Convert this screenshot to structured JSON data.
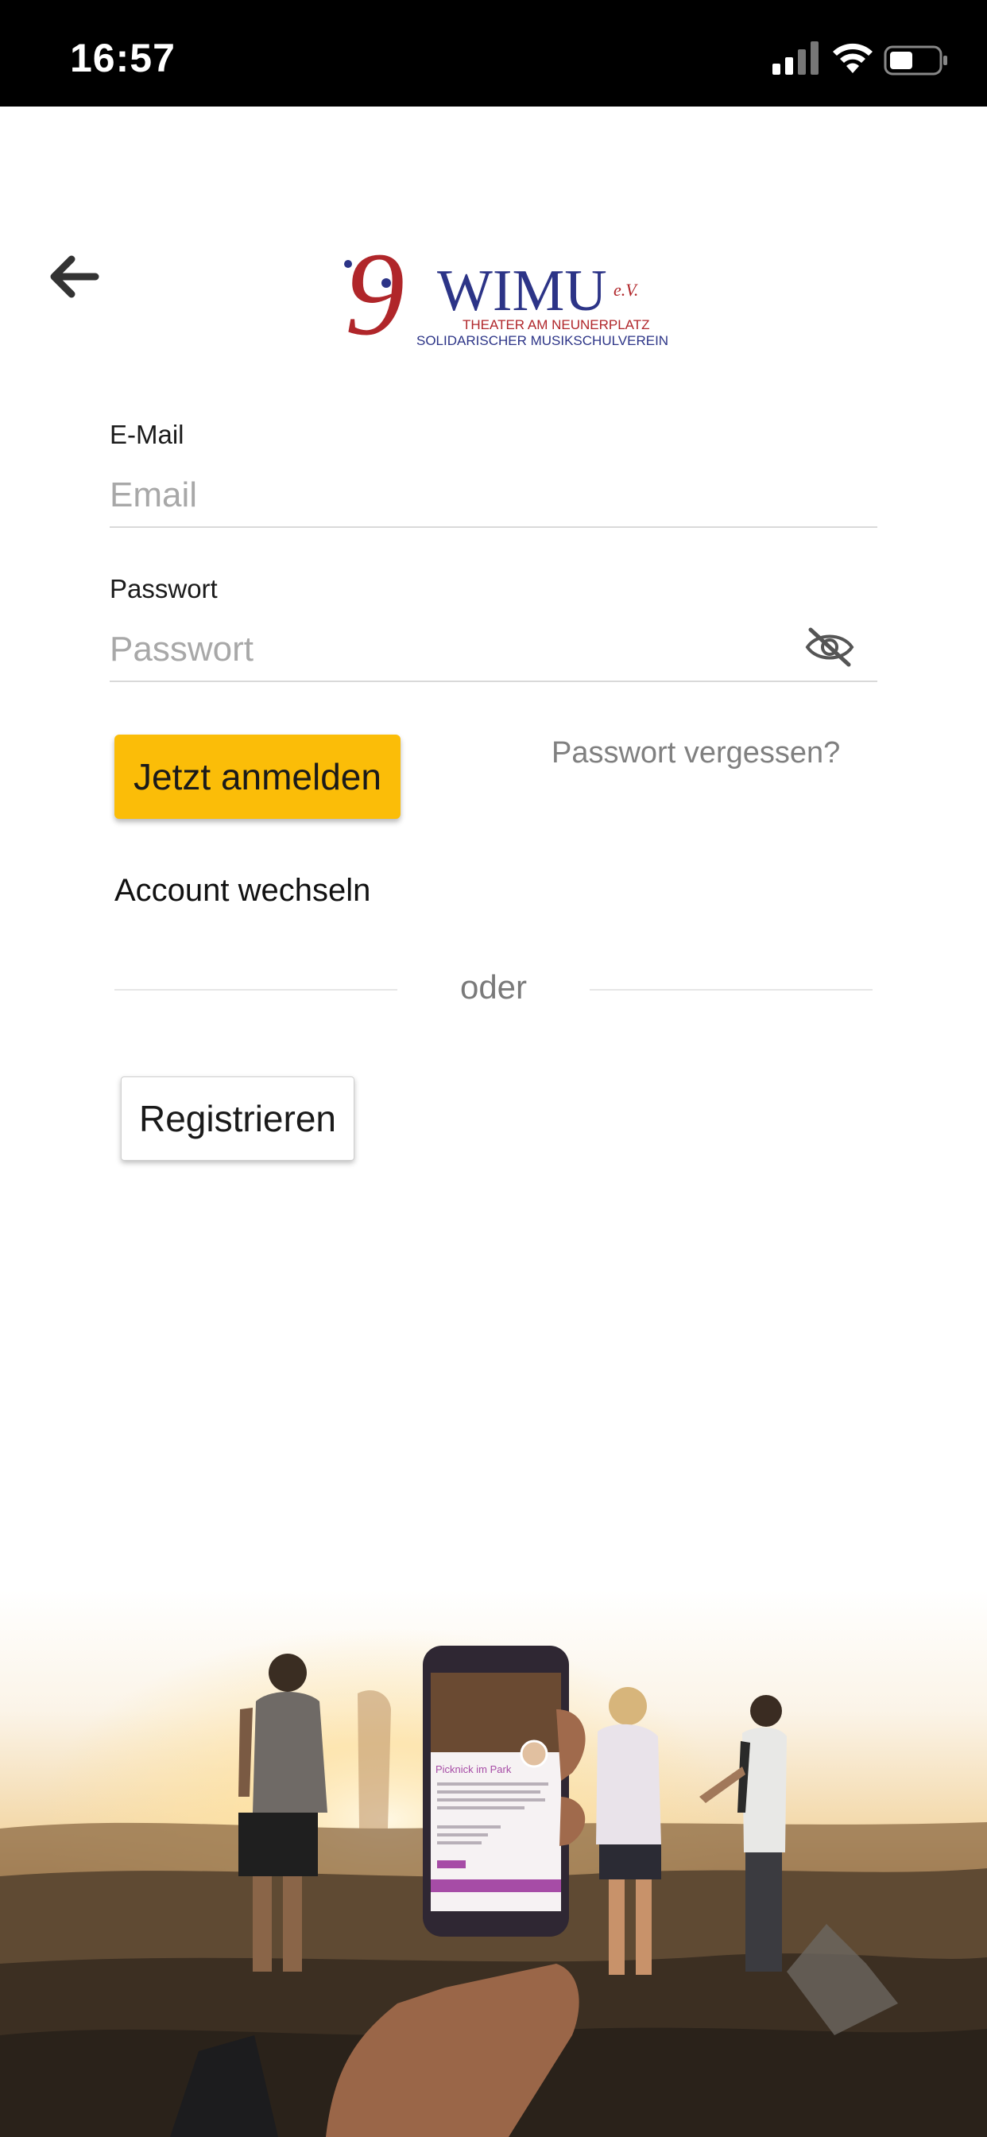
{
  "status_bar": {
    "time": "16:57"
  },
  "header": {
    "back_icon": "arrow-left-icon",
    "logo": {
      "wordmark": "WIMU",
      "suffix": "e.V.",
      "line1": "THEATER AM NEUNERPLATZ",
      "line2": "SOLIDARISCHER MUSIKSCHULVEREIN",
      "colors": {
        "red": "#b0262a",
        "navy": "#2c3487"
      }
    }
  },
  "form": {
    "email": {
      "label": "E-Mail",
      "placeholder": "Email",
      "value": ""
    },
    "password": {
      "label": "Passwort",
      "placeholder": "Passwort",
      "value": "",
      "toggle_icon": "eye-slash-icon"
    },
    "login_label": "Jetzt anmelden",
    "forgot_label": "Passwort vergessen?",
    "switch_account_label": "Account wechseln",
    "or_label": "oder",
    "register_label": "Registrieren"
  },
  "hero_phone": {
    "event_title": "Picknick im Park"
  },
  "colors": {
    "accent": "#fbbd08",
    "phone_accent": "#a64ca6"
  }
}
